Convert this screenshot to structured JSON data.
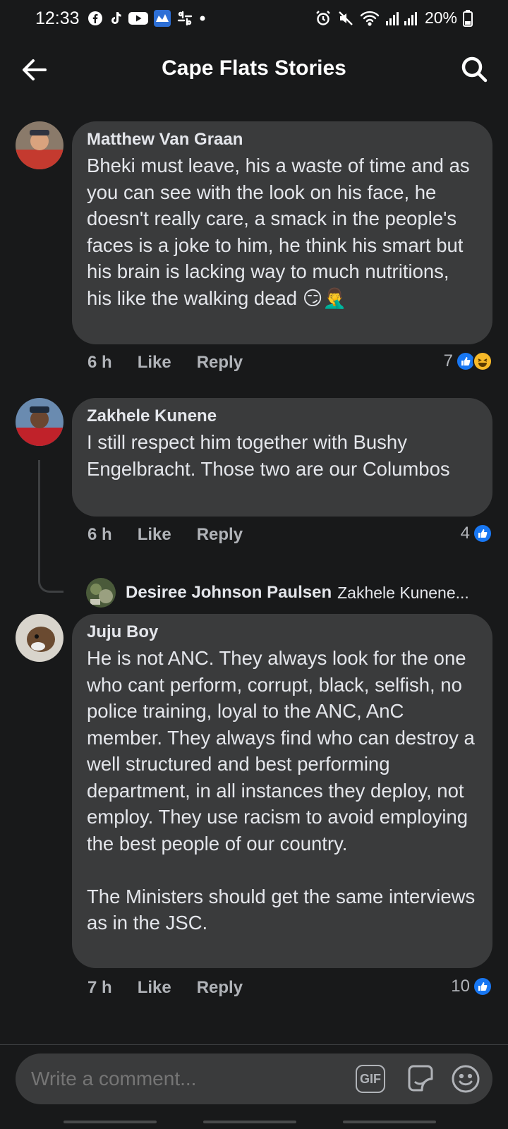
{
  "status_bar": {
    "time": "12:33",
    "battery": "20%",
    "left_icons": [
      "facebook-icon",
      "tiktok-icon",
      "youtube-icon",
      "news-app-icon",
      "slack-icon",
      "dot-icon"
    ],
    "right_icons": [
      "alarm-icon",
      "mute-icon",
      "wifi-icon",
      "signal-icon",
      "battery-icon"
    ]
  },
  "header": {
    "title": "Cape Flats Stories"
  },
  "comments": [
    {
      "author": "Matthew Van Graan",
      "text": "Bheki must leave, his a waste of time and as you can see with the look on his face, he doesn't really care, a smack in the people's faces is a joke to him, he think his smart but his brain is lacking way to much nutritions, his like the walking dead 😏🤦‍♂️",
      "time": "6 h",
      "like_label": "Like",
      "reply_label": "Reply",
      "reaction_count": "7",
      "reactions": [
        "like",
        "haha"
      ]
    },
    {
      "author": "Zakhele Kunene",
      "text": "I still respect him together with Bushy Engelbracht. Those two are our Columbos",
      "time": "6 h",
      "like_label": "Like",
      "reply_label": "Reply",
      "reaction_count": "4",
      "reactions": [
        "like"
      ],
      "reply_preview": {
        "author": "Desiree Johnson Paulsen",
        "text": "Zakhele Kunene..."
      }
    },
    {
      "author": "Juju Boy",
      "text": "He is not ANC. They always look for the one who cant perform, corrupt, black, selfish, no police training, loyal to the ANC, AnC member. They always find who can destroy a well structured and best performing department, in all instances they deploy, not employ. They use racism to avoid employing the best people of our country.\n\nThe Ministers should get the same interviews as in the JSC.",
      "time": "7 h",
      "like_label": "Like",
      "reply_label": "Reply",
      "reaction_count": "10",
      "reactions": [
        "like"
      ]
    }
  ],
  "composer": {
    "placeholder": "Write a comment...",
    "gif_label": "GIF"
  },
  "colors": {
    "background": "#18191a",
    "bubble": "#3a3b3c",
    "text": "#e4e6eb",
    "secondary_text": "#b0b3b8",
    "like_blue": "#1877f2",
    "haha_yellow": "#f7b928"
  }
}
